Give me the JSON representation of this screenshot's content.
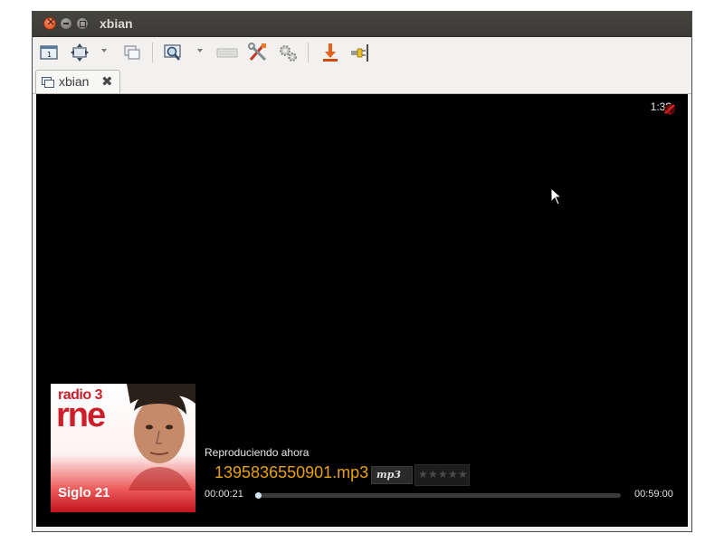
{
  "window": {
    "title": "xbian"
  },
  "toolbar": {
    "icons": [
      "screen-1-icon",
      "scale-icon",
      "dropdown-arrow",
      "windows-icon",
      "zoom-icon",
      "dropdown-arrow",
      "keyboard-icon",
      "tools-icon",
      "settings-icon",
      "download-icon",
      "disconnect-icon"
    ]
  },
  "tab": {
    "label": "xbian",
    "close_glyph": "✖"
  },
  "screen": {
    "clock": "1:3?",
    "now_playing_label": "Reproduciendo ahora",
    "file_name": "1395836550901.mp3",
    "codec": "mp3",
    "elapsed": "00:00:21",
    "duration": "00:59:00",
    "progress": 0.006,
    "rating": 0,
    "rating_max": 5,
    "cover": {
      "brand_top": "radio 3",
      "brand_main": "rne",
      "show": "Siglo 21"
    }
  },
  "colors": {
    "titlebar": "#3c3b37",
    "accent_title": "#e8a015",
    "brand_red": "#cc1f29",
    "progress_fill": "#9fc6e8"
  }
}
